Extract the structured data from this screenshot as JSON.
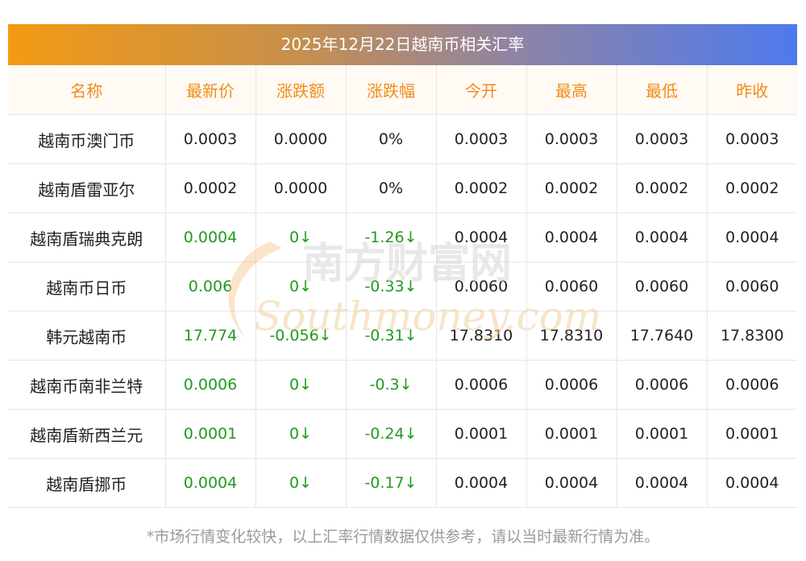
{
  "title": "2025年12月22日越南币相关汇率",
  "columns": [
    "名称",
    "最新价",
    "涨跌额",
    "涨跌幅",
    "今开",
    "最高",
    "最低",
    "昨收"
  ],
  "rows": [
    {
      "name": "越南币澳门币",
      "latest": "0.0003",
      "change": "0.0000",
      "pct": "0%",
      "open": "0.0003",
      "high": "0.0003",
      "low": "0.0003",
      "prev": "0.0003",
      "down": false
    },
    {
      "name": "越南盾雷亚尔",
      "latest": "0.0002",
      "change": "0.0000",
      "pct": "0%",
      "open": "0.0002",
      "high": "0.0002",
      "low": "0.0002",
      "prev": "0.0002",
      "down": false
    },
    {
      "name": "越南盾瑞典克朗",
      "latest": "0.0004",
      "change": "0↓",
      "pct": "-1.26↓",
      "open": "0.0004",
      "high": "0.0004",
      "low": "0.0004",
      "prev": "0.0004",
      "down": true
    },
    {
      "name": "越南币日币",
      "latest": "0.006",
      "change": "0↓",
      "pct": "-0.33↓",
      "open": "0.0060",
      "high": "0.0060",
      "low": "0.0060",
      "prev": "0.0060",
      "down": true
    },
    {
      "name": "韩元越南币",
      "latest": "17.774",
      "change": "-0.056↓",
      "pct": "-0.31↓",
      "open": "17.8310",
      "high": "17.8310",
      "low": "17.7640",
      "prev": "17.8300",
      "down": true
    },
    {
      "name": "越南币南非兰特",
      "latest": "0.0006",
      "change": "0↓",
      "pct": "-0.3↓",
      "open": "0.0006",
      "high": "0.0006",
      "low": "0.0006",
      "prev": "0.0006",
      "down": true
    },
    {
      "name": "越南盾新西兰元",
      "latest": "0.0001",
      "change": "0↓",
      "pct": "-0.24↓",
      "open": "0.0001",
      "high": "0.0001",
      "low": "0.0001",
      "prev": "0.0001",
      "down": true
    },
    {
      "name": "越南盾挪币",
      "latest": "0.0004",
      "change": "0↓",
      "pct": "-0.17↓",
      "open": "0.0004",
      "high": "0.0004",
      "low": "0.0004",
      "prev": "0.0004",
      "down": true
    }
  ],
  "watermark": {
    "cn": "南方财富网",
    "en": "Southmoney.com"
  },
  "footnote": "*市场行情变化较快，以上汇率行情数据仅供参考，请以当时最新行情为准。",
  "colors": {
    "header_text": "#f08c1a",
    "down": "#1f9a1f",
    "gradient_start": "#f39a12",
    "gradient_end": "#4e7aee"
  }
}
